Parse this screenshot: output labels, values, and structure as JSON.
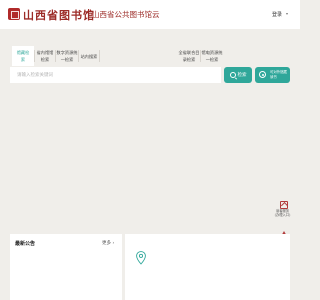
{
  "header": {
    "logo_text": "山西省图书馆",
    "subtitle": "山西省公共图书馆云",
    "login_label": "登录",
    "colors": {
      "brand": "#9c2b27",
      "background": "#ffffff"
    }
  },
  "search": {
    "tabs": [
      {
        "label": "馆藏检索",
        "active": true
      },
      {
        "label": "省内馆馆检索"
      },
      {
        "label": "数字资源统一检索"
      },
      {
        "label": "站内搜索"
      },
      {
        "label": "全省联合目录检索"
      },
      {
        "label": "馆电资源统一检索"
      }
    ],
    "placeholder": "请输入检索关键词",
    "value": "",
    "button_label": "检索",
    "unified_label": "可对外馆藏读书",
    "colors": {
      "accent": "#2fa79a"
    }
  },
  "sidebar": {
    "items": [
      {
        "label": "读者服务",
        "sub": "(办理入口)",
        "icon": "reader-card-icon"
      },
      {
        "label": "返回顶部",
        "icon": "back-to-top-icon"
      }
    ]
  },
  "notice": {
    "title": "最新公告",
    "more_label": "更多"
  },
  "map": {
    "icon": "location-pin-icon"
  }
}
